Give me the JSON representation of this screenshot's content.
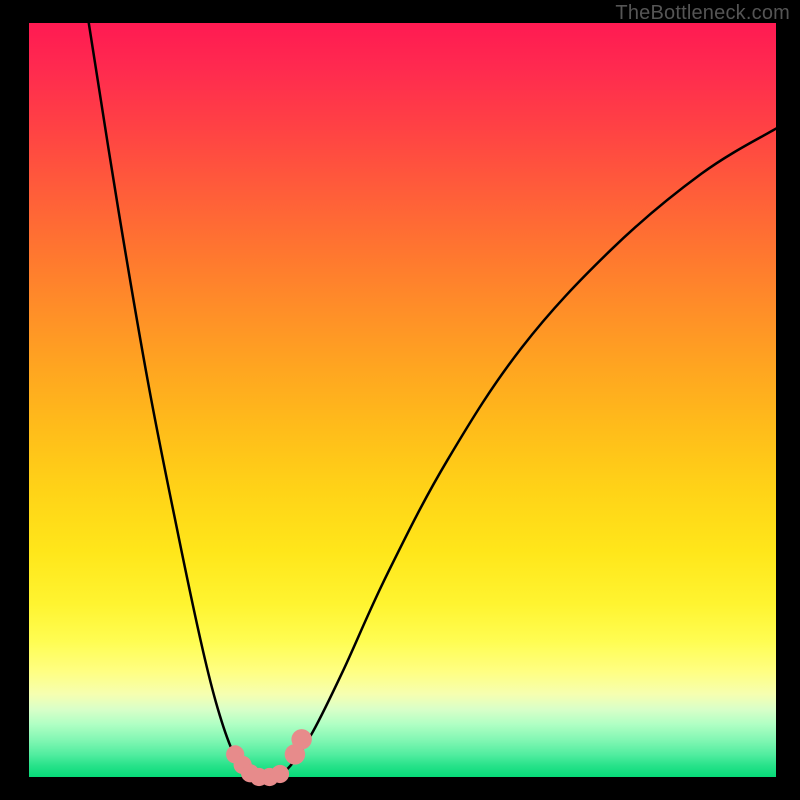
{
  "watermark": "TheBottleneck.com",
  "chart_data": {
    "type": "line",
    "title": "",
    "xlabel": "",
    "ylabel": "",
    "ylim": [
      0,
      100
    ],
    "xlim": [
      0,
      100
    ],
    "series": [
      {
        "name": "left-curve",
        "x": [
          8,
          12,
          16,
          20,
          23,
          25,
          27,
          28.5,
          30,
          31
        ],
        "values": [
          100,
          75,
          52,
          32,
          18,
          10,
          4,
          1.5,
          0.2,
          0
        ]
      },
      {
        "name": "right-curve",
        "x": [
          33,
          35,
          38,
          42,
          48,
          56,
          66,
          78,
          90,
          100
        ],
        "values": [
          0,
          1.5,
          6,
          14,
          27,
          42,
          57,
          70,
          80,
          86
        ]
      },
      {
        "name": "floor",
        "x": [
          31,
          32,
          33
        ],
        "values": [
          0,
          0,
          0
        ]
      }
    ],
    "markers": {
      "name": "highlight-points",
      "points": [
        {
          "x": 27.6,
          "y": 3.0,
          "r": 1.1
        },
        {
          "x": 28.6,
          "y": 1.6,
          "r": 1.1
        },
        {
          "x": 29.6,
          "y": 0.5,
          "r": 1.1
        },
        {
          "x": 30.8,
          "y": 0.0,
          "r": 1.1
        },
        {
          "x": 32.2,
          "y": 0.0,
          "r": 1.1
        },
        {
          "x": 33.6,
          "y": 0.4,
          "r": 1.1
        },
        {
          "x": 35.6,
          "y": 3.0,
          "r": 1.4
        },
        {
          "x": 36.5,
          "y": 5.0,
          "r": 1.4
        }
      ]
    },
    "gradient_stops": [
      {
        "pct": 0,
        "color": "#ff1a52"
      },
      {
        "pct": 50,
        "color": "#ffbd1a"
      },
      {
        "pct": 85,
        "color": "#ffff82"
      },
      {
        "pct": 100,
        "color": "#06da78"
      }
    ]
  }
}
